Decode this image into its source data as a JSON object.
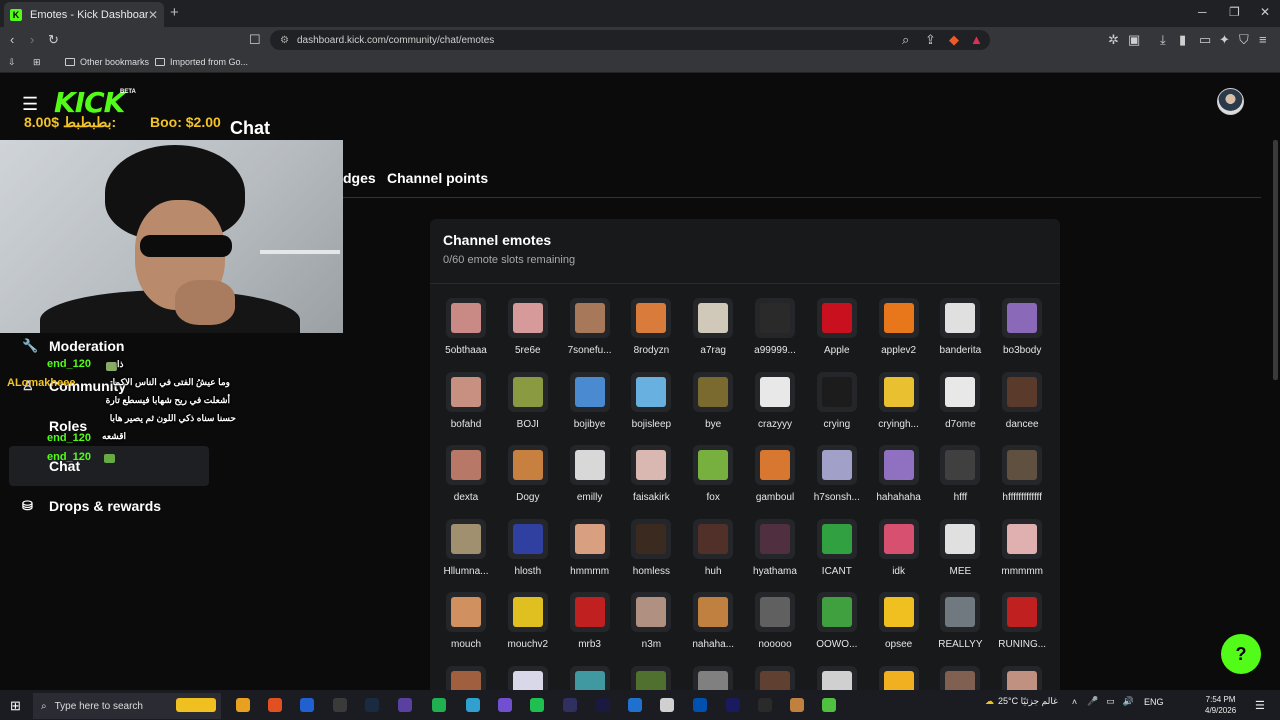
{
  "browser": {
    "tab_title": "Emotes - Kick Dashboard",
    "tab_favicon_letter": "K",
    "url": "dashboard.kick.com/community/chat/emotes",
    "bookmarks": [
      "Other bookmarks",
      "Imported from Go..."
    ],
    "new_tab_symbol": "+",
    "tab_close_symbol": "✕"
  },
  "header": {
    "logo": "KICK",
    "logo_badge": "BETA"
  },
  "overlay": {
    "donation_a": "8.00$ بطبطبط:",
    "donation_b": "Boo: $2.00",
    "chat_heading": "Chat",
    "chat": [
      {
        "name": "end_120",
        "message": "ذا"
      },
      {
        "name": "ALomakheee",
        "message": "وما عيشُ الفتى في الناس الاكما"
      },
      {
        "name": "",
        "message": "أشعلت في ريح شهابا فيسطع تارة"
      },
      {
        "name": "",
        "message": "حسنا سناه ذكي اللون ثم يصير هابا"
      },
      {
        "name": "end_120",
        "message": "اقشعه"
      },
      {
        "name": "end_120",
        "message": ""
      }
    ]
  },
  "tabs": [
    {
      "label": "dges"
    },
    {
      "label": "Channel points"
    }
  ],
  "sidebar": {
    "items": [
      {
        "label": "Moderation",
        "icon": "wrench-icon"
      },
      {
        "label": "Community",
        "icon": "users-icon"
      },
      {
        "label": "Roles",
        "icon": ""
      },
      {
        "label": "Chat",
        "icon": ""
      },
      {
        "label": "Drops & rewards",
        "icon": "gift-icon"
      }
    ]
  },
  "panel": {
    "title": "Channel emotes",
    "subtitle": "0/60 emote slots remaining"
  },
  "emotes": [
    {
      "name": "5obthaaa",
      "color": "#c98a86"
    },
    {
      "name": "5re6e",
      "color": "#d79a9a"
    },
    {
      "name": "7sonefu...",
      "color": "#a8785a"
    },
    {
      "name": "8rodyzn",
      "color": "#d97b3a"
    },
    {
      "name": "a7rag",
      "color": "#d0c8b8"
    },
    {
      "name": "a99999...",
      "color": "#2a2a2a"
    },
    {
      "name": "Apple",
      "color": "#c8101e"
    },
    {
      "name": "applev2",
      "color": "#e8761a"
    },
    {
      "name": "banderita",
      "color": "#e0e0e0"
    },
    {
      "name": "bo3body",
      "color": "#8a6ab8"
    },
    {
      "name": "bofahd",
      "color": "#c79080"
    },
    {
      "name": "BOJI",
      "color": "#8a9a40"
    },
    {
      "name": "bojibye",
      "color": "#4a8ad0"
    },
    {
      "name": "bojisleep",
      "color": "#68b0e0"
    },
    {
      "name": "bye",
      "color": "#7a6a30"
    },
    {
      "name": "crazyyy",
      "color": "#e8e8e8"
    },
    {
      "name": "crying",
      "color": "#1c1c1c"
    },
    {
      "name": "cryingh...",
      "color": "#e8c030"
    },
    {
      "name": "d7ome",
      "color": "#e8e8e8"
    },
    {
      "name": "dancee",
      "color": "#5a3a2a"
    },
    {
      "name": "dexta",
      "color": "#b87868"
    },
    {
      "name": "Dogy",
      "color": "#c88040"
    },
    {
      "name": "emilly",
      "color": "#d8d8d8"
    },
    {
      "name": "faisakirk",
      "color": "#d8b8b0"
    },
    {
      "name": "fox",
      "color": "#78b040"
    },
    {
      "name": "gamboul",
      "color": "#d87830"
    },
    {
      "name": "h7sonsh...",
      "color": "#a0a0c8"
    },
    {
      "name": "hahahaha",
      "color": "#9070c0"
    },
    {
      "name": "hfff",
      "color": "#404040"
    },
    {
      "name": "hfffffffffffff",
      "color": "#605040"
    },
    {
      "name": "Hllumna...",
      "color": "#a09070"
    },
    {
      "name": "hlosth",
      "color": "#3040a0"
    },
    {
      "name": "hmmmm",
      "color": "#d8a080"
    },
    {
      "name": "homless",
      "color": "#3a2a20"
    },
    {
      "name": "huh",
      "color": "#503028"
    },
    {
      "name": "hyathama",
      "color": "#503040"
    },
    {
      "name": "ICANT",
      "color": "#30a040"
    },
    {
      "name": "idk",
      "color": "#d85070"
    },
    {
      "name": "MEE",
      "color": "#e0e0e0"
    },
    {
      "name": "mmmmm",
      "color": "#e0b0b0"
    },
    {
      "name": "mouch",
      "color": "#d09060"
    },
    {
      "name": "mouchv2",
      "color": "#e0c020"
    },
    {
      "name": "mrb3",
      "color": "#c02020"
    },
    {
      "name": "n3m",
      "color": "#b09080"
    },
    {
      "name": "nahaha...",
      "color": "#c08040"
    },
    {
      "name": "nooooo",
      "color": "#606060"
    },
    {
      "name": "OOWO...",
      "color": "#40a040"
    },
    {
      "name": "opsee",
      "color": "#f0c020"
    },
    {
      "name": "REALLYY",
      "color": "#707880"
    },
    {
      "name": "RUNING...",
      "color": "#c02020"
    },
    {
      "name": "",
      "color": "#a06040"
    },
    {
      "name": "",
      "color": "#d8d8e8"
    },
    {
      "name": "",
      "color": "#4098a0"
    },
    {
      "name": "",
      "color": "#507030"
    },
    {
      "name": "",
      "color": "#808080"
    },
    {
      "name": "",
      "color": "#604030"
    },
    {
      "name": "",
      "color": "#d0d0d0"
    },
    {
      "name": "",
      "color": "#f0b020"
    },
    {
      "name": "",
      "color": "#806050"
    },
    {
      "name": "",
      "color": "#c09080"
    }
  ],
  "help_symbol": "?",
  "taskbar": {
    "search_placeholder": "Type here to search",
    "weather": "25°C غالم جزئيًا",
    "lang": "ENG",
    "time": "7:54 PM",
    "date": "4/9/2026",
    "apps": [
      "#f0c020",
      "#e8a020",
      "#e05020",
      "#2060d0",
      "#3a3a3a",
      "#1a2a40",
      "#5a40a0",
      "#20b050",
      "#30a0d0",
      "#7050d0",
      "#20c050",
      "#303060",
      "#1a1a40",
      "#2070d0",
      "#d0d0d0",
      "#0050b0",
      "#1a1a60",
      "#2a2a2a",
      "#c08040",
      "#50c040"
    ],
    "colors": {
      "bar": "#1b1c22"
    }
  },
  "colors": {
    "accent": "#53fc18",
    "overlay_text": "#f3c425",
    "panel": "#18191b"
  }
}
